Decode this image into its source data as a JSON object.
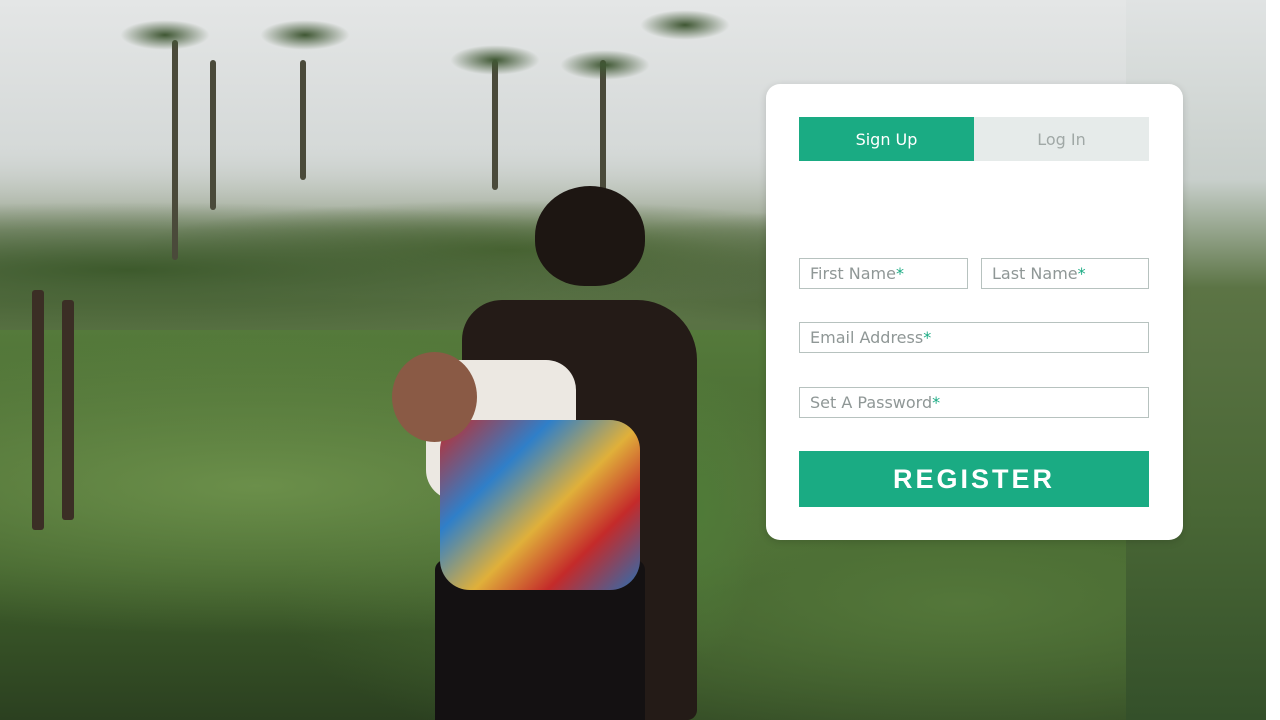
{
  "tabs": {
    "signup_label": "Sign Up",
    "login_label": "Log In",
    "active": "Sign Up"
  },
  "form": {
    "first_name_placeholder": "First Name",
    "last_name_placeholder": "Last Name",
    "email_placeholder": "Email Address",
    "password_placeholder": "Set A Password",
    "required_marker": "*",
    "register_label": "REGISTER"
  },
  "colors": {
    "accent": "#1aab83",
    "inactive_tab_bg": "#e6ebea",
    "inactive_tab_text": "#a0a8a6",
    "placeholder_text": "#8f9796"
  },
  "background": {
    "image": "photo-woman-carrying-baby-in-field"
  }
}
